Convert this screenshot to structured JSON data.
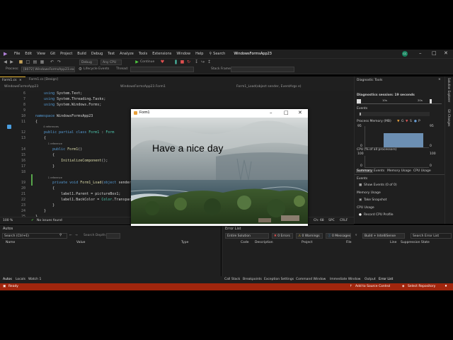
{
  "menu": {
    "items": [
      "File",
      "Edit",
      "View",
      "Git",
      "Project",
      "Build",
      "Debug",
      "Test",
      "Analyze",
      "Tools",
      "Extensions",
      "Window",
      "Help"
    ],
    "search": "Search",
    "solution_title": "WindowsFormsApp23",
    "user_badge": "CC"
  },
  "toolbar": {
    "config": "Debug",
    "platform": "Any CPU",
    "continue": "Continue",
    "process_label": "Process:",
    "process_value": "[8072] WindowsFormsApp23.exe",
    "lifecycle": "Lifecycle Events",
    "thread_label": "Thread:",
    "stack_frame": "Stack Frame:"
  },
  "editor": {
    "tabs": [
      {
        "label": "Form1.cs",
        "active": true
      },
      {
        "label": "Form1.cs [Design]",
        "active": false
      }
    ],
    "nav": {
      "project": "WindowsFormsApp23",
      "class": "WindowsFormsApp23.Form1",
      "member": "Form1_Load(object sender, EventArgs e)"
    },
    "lines": [
      {
        "n": "6",
        "code": [
          [
            "pl",
            "    "
          ],
          [
            "kw",
            "using "
          ],
          [
            "pl",
            "System.Text;"
          ]
        ]
      },
      {
        "n": "7",
        "code": [
          [
            "pl",
            "    "
          ],
          [
            "kw",
            "using "
          ],
          [
            "pl",
            "System.Threading.Tasks;"
          ]
        ]
      },
      {
        "n": "8",
        "code": [
          [
            "pl",
            "    "
          ],
          [
            "kw",
            "using "
          ],
          [
            "pl",
            "System.Windows.Forms;"
          ]
        ]
      },
      {
        "n": "9",
        "code": []
      },
      {
        "n": "10",
        "code": [
          [
            "kw",
            "namespace "
          ],
          [
            "pl",
            "WindowsFormsApp23"
          ]
        ]
      },
      {
        "n": "11",
        "code": [
          [
            "pl",
            "{"
          ]
        ]
      },
      {
        "n": "",
        "code": [
          [
            "rf",
            "          4 references"
          ]
        ]
      },
      {
        "n": "12",
        "code": [
          [
            "pl",
            "    "
          ],
          [
            "kw",
            "public partial class "
          ],
          [
            "ty",
            "Form1"
          ],
          [
            "pl",
            " : "
          ],
          [
            "ty",
            "Form"
          ]
        ]
      },
      {
        "n": "13",
        "code": [
          [
            "pl",
            "    {"
          ]
        ]
      },
      {
        "n": "",
        "code": [
          [
            "rf",
            "                1 reference"
          ]
        ]
      },
      {
        "n": "14",
        "code": [
          [
            "pl",
            "        "
          ],
          [
            "kw",
            "public "
          ],
          [
            "fn",
            "Form1"
          ],
          [
            "pl",
            "()"
          ]
        ]
      },
      {
        "n": "15",
        "code": [
          [
            "pl",
            "        {"
          ]
        ]
      },
      {
        "n": "16",
        "code": [
          [
            "pl",
            "            "
          ],
          [
            "fn",
            "InitializeComponent"
          ],
          [
            "pl",
            "();"
          ]
        ]
      },
      {
        "n": "17",
        "code": [
          [
            "pl",
            "        }"
          ]
        ]
      },
      {
        "n": "18",
        "code": []
      },
      {
        "n": "",
        "code": [
          [
            "rf",
            "                1 reference"
          ]
        ]
      },
      {
        "n": "19",
        "code": [
          [
            "pl",
            "        "
          ],
          [
            "kw",
            "private void "
          ],
          [
            "fn",
            "Form1_Load"
          ],
          [
            "pl",
            "("
          ],
          [
            "kw",
            "object "
          ],
          [
            "pl",
            "sender, "
          ],
          [
            "ty",
            "EventArgs "
          ],
          [
            "pl",
            "e)"
          ]
        ]
      },
      {
        "n": "20",
        "code": [
          [
            "pl",
            "        {"
          ]
        ]
      },
      {
        "n": "21",
        "code": [
          [
            "pl",
            "            label1.Parent = pictureBox1;"
          ]
        ]
      },
      {
        "n": "22",
        "code": [
          [
            "pl",
            "            label1.BackColor = "
          ],
          [
            "ty",
            "Color"
          ],
          [
            "pl",
            "."
          ],
          [
            "pl",
            "Transparent;"
          ]
        ]
      },
      {
        "n": "23",
        "code": [
          [
            "pl",
            "        }"
          ]
        ]
      },
      {
        "n": "24",
        "code": [
          [
            "pl",
            "    }"
          ]
        ]
      },
      {
        "n": "25",
        "code": [
          [
            "pl",
            "}"
          ]
        ]
      }
    ],
    "status": {
      "zoom": "100 %",
      "issues": "No issues found",
      "position": "Ch: 68",
      "spc": "SPC",
      "eol": "CRLF"
    }
  },
  "form": {
    "title": "Form1",
    "label": "Have a nice day"
  },
  "diag": {
    "title": "Diagnostic Tools",
    "session": "Diagnostics session: 19 seconds",
    "ticks": [
      "10s",
      "20s"
    ],
    "events_label": "Events",
    "memory_label": "Process Memory (MB)",
    "legend": [
      "G",
      "S",
      "P"
    ],
    "mem_ticks": [
      "95",
      "0"
    ],
    "cpu_label": "CPU (% of all processors)",
    "cpu_ticks": [
      "100",
      "0"
    ],
    "tabs": [
      "Summary",
      "Events",
      "Memory Usage",
      "CPU Usage"
    ],
    "events_header": "Events",
    "show_events": "Show Events (0 of 0)",
    "memory_usage": "Memory Usage",
    "take_snapshot": "Take Snapshot",
    "cpu_usage": "CPU Usage",
    "record_cpu": "Record CPU Profile",
    "rail": [
      "Solution Explorer",
      "Git Changes"
    ]
  },
  "autos": {
    "title": "Autos",
    "search": "Search (Ctrl+E)",
    "search_depth": "Search Depth:",
    "columns": [
      "Name",
      "Value",
      "Type"
    ]
  },
  "errors": {
    "title": "Error List",
    "scope": "Entire Solution",
    "errors": "0 Errors",
    "warnings": "0 Warnings",
    "messages": "0 Messages",
    "build_filter": "Build + IntelliSense",
    "search": "Search Error List",
    "columns": [
      "Code",
      "Description",
      "Project",
      "File",
      "Line",
      "Suppression State"
    ]
  },
  "bottom_tabs_left": [
    "Autos",
    "Locals",
    "Watch 1"
  ],
  "bottom_tabs_right": [
    "Call Stack",
    "Breakpoints",
    "Exception Settings",
    "Command Window",
    "Immediate Window",
    "Output",
    "Error List"
  ],
  "status": {
    "ready": "Ready",
    "source_control": "Add to Source Control",
    "repository": "Select Repository"
  }
}
